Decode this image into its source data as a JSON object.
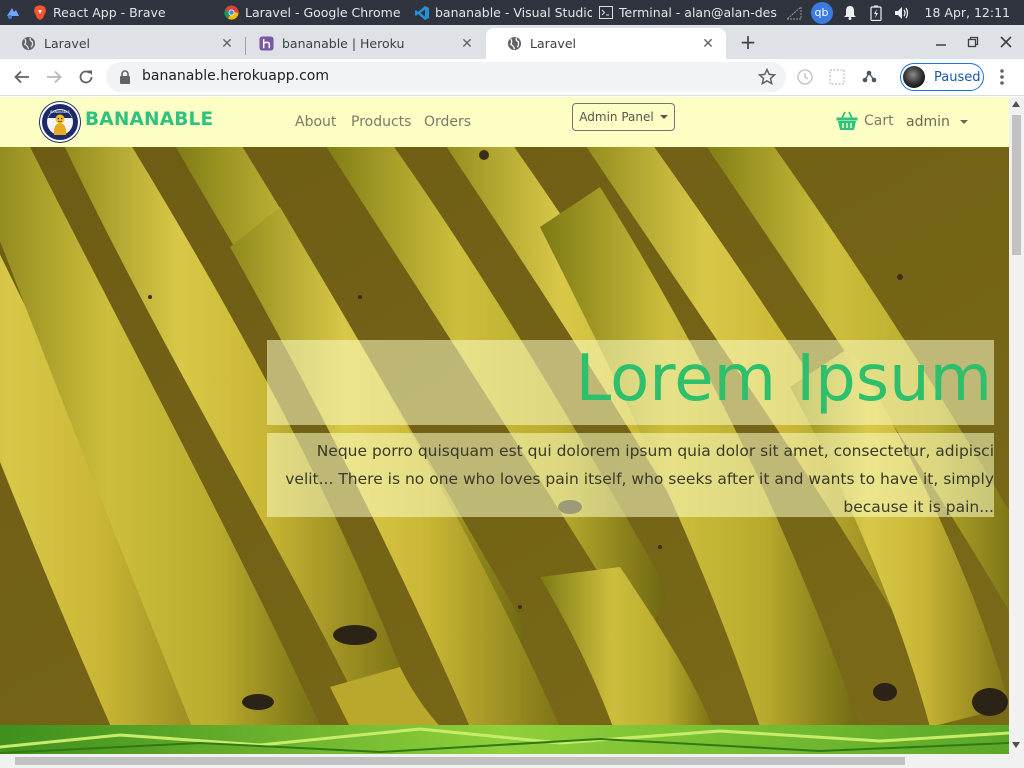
{
  "taskbar": {
    "tasks": [
      {
        "label": "React App - Brave"
      },
      {
        "label": "Laravel - Google Chrome"
      },
      {
        "label": "bananable - Visual Studio ..."
      },
      {
        "label": "Terminal - alan@alan-desk..."
      }
    ],
    "tray_qb": "qb",
    "clock": "18 Apr, 12:11"
  },
  "browser": {
    "tabs": [
      {
        "title": "Laravel"
      },
      {
        "title": "bananable | Heroku"
      },
      {
        "title": "Laravel"
      }
    ],
    "url": "bananable.herokuapp.com",
    "profile_label": "Paused"
  },
  "site": {
    "brand": "BANANABLE",
    "logo_text": "BANANABLE",
    "nav": [
      "About",
      "Products",
      "Orders"
    ],
    "admin_panel": "Admin Panel",
    "cart": "Cart",
    "user": "admin",
    "hero_title": "Lorem Ipsum",
    "hero_text": "Neque porro quisquam est qui dolorem ipsum quia dolor sit amet, consectetur, adipisci velit... There is no one who loves pain itself, who seeks after it and wants to have it, simply because it is pain..."
  },
  "colors": {
    "brand_green": "#2ec27e",
    "nav_bg": "#fcfec4",
    "taskbar_bg": "#2f343f",
    "tabstrip_bg": "#dee1e6"
  }
}
